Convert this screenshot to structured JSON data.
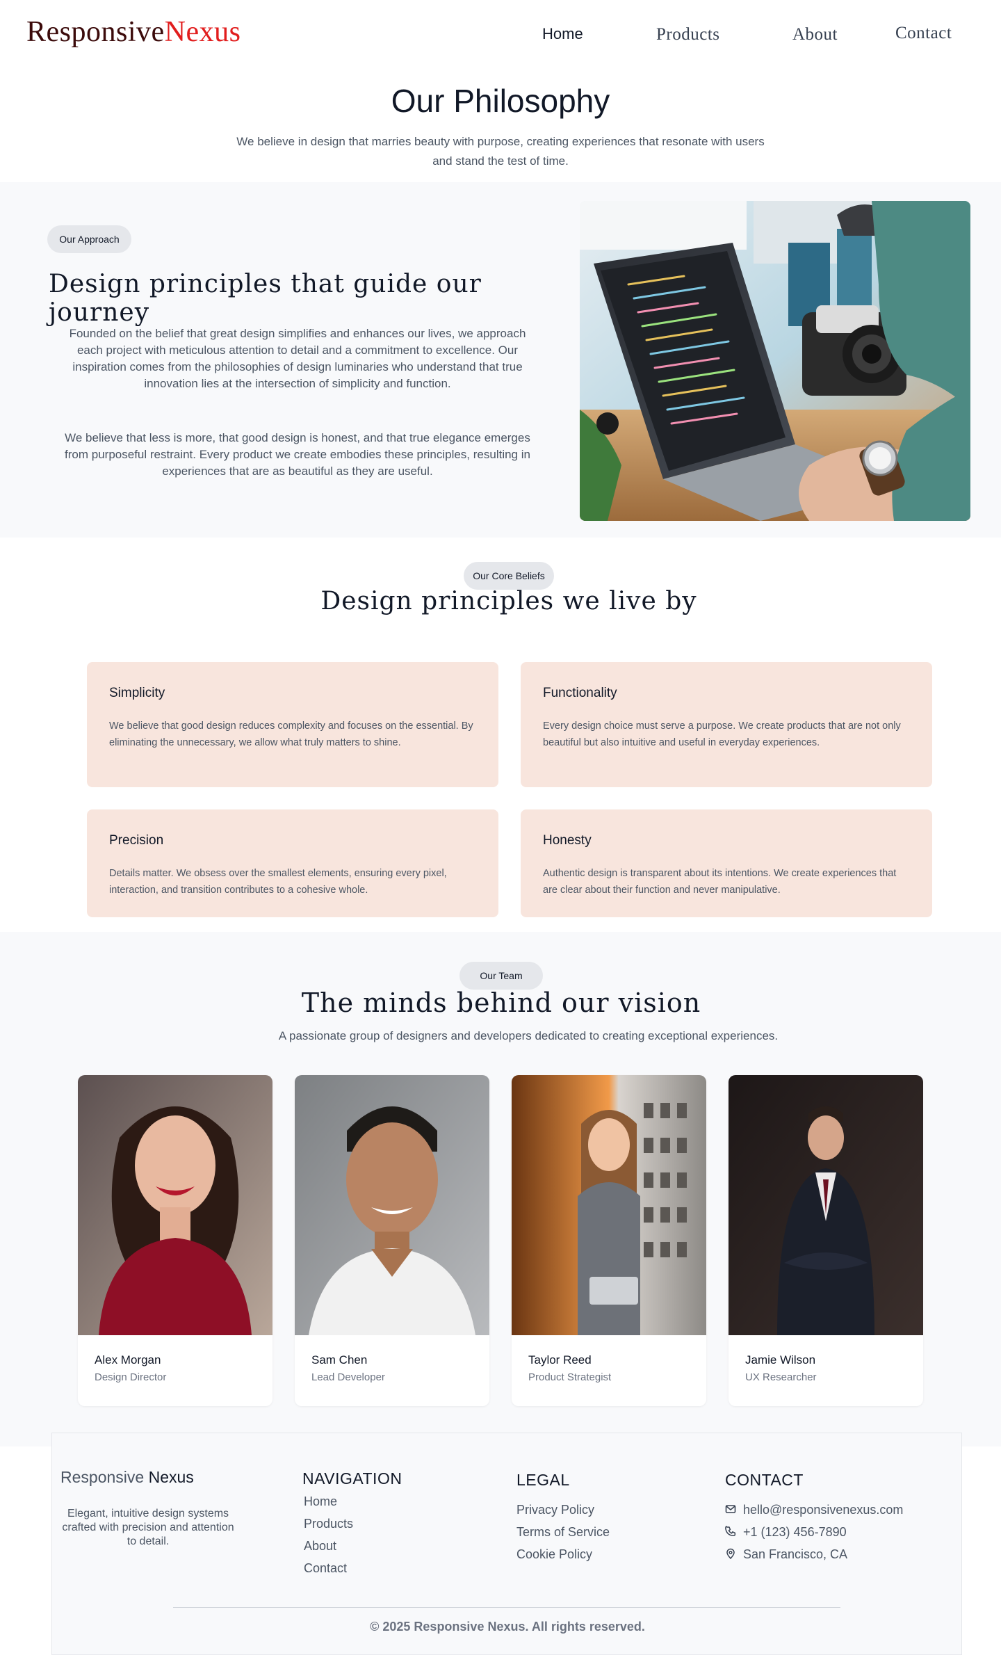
{
  "header": {
    "logo_part1": "Responsive",
    "logo_part2": "Nexus",
    "nav": [
      "Home",
      "Products",
      "About",
      "Contact"
    ]
  },
  "philosophy": {
    "title": "Our Philosophy",
    "subtitle": "We believe in design that marries beauty with purpose, creating experiences that resonate with users and stand the test of time."
  },
  "approach": {
    "badge": "Our Approach",
    "heading": "Design principles that guide our journey",
    "paragraph1": "Founded on the belief that great design simplifies and enhances our lives, we approach each project with meticulous attention to detail and a commitment to excellence. Our inspiration comes from the philosophies of design luminaries who understand that true innovation lies at the intersection of simplicity and function.",
    "paragraph2": "We believe that less is more, that good design is honest, and that true elegance emerges from purposeful restraint. Every product we create embodies these principles, resulting in experiences that are as beautiful as they are useful."
  },
  "beliefs": {
    "badge": "Our Core Beliefs",
    "heading": "Design principles we live by",
    "cards": [
      {
        "title": "Simplicity",
        "text": "We believe that good design reduces complexity and focuses on the essential. By eliminating the unnecessary, we allow what truly matters to shine."
      },
      {
        "title": "Functionality",
        "text": "Every design choice must serve a purpose. We create products that are not only beautiful but also intuitive and useful in everyday experiences."
      },
      {
        "title": "Precision",
        "text": "Details matter. We obsess over the smallest elements, ensuring every pixel, interaction, and transition contributes to a cohesive whole."
      },
      {
        "title": "Honesty",
        "text": "Authentic design is transparent about its intentions. We create experiences that are clear about their function and never manipulative."
      }
    ]
  },
  "team": {
    "badge": "Our Team",
    "heading": "The minds behind our vision",
    "subtitle": "A passionate group of designers and developers dedicated to creating exceptional experiences.",
    "members": [
      {
        "name": "Alex Morgan",
        "role": "Design Director"
      },
      {
        "name": "Sam Chen",
        "role": "Lead Developer"
      },
      {
        "name": "Taylor Reed",
        "role": "Product Strategist"
      },
      {
        "name": "Jamie Wilson",
        "role": "UX Researcher"
      }
    ]
  },
  "footer": {
    "brand_part1": "Responsive",
    "brand_part2": "Nexus",
    "description": "Elegant, intuitive design systems crafted with precision and attention to detail.",
    "navigation": {
      "heading": "NAVIGATION",
      "links": [
        "Home",
        "Products",
        "About",
        "Contact"
      ]
    },
    "legal": {
      "heading": "LEGAL",
      "links": [
        "Privacy Policy",
        "Terms of Service",
        "Cookie Policy"
      ]
    },
    "contact": {
      "heading": "CONTACT",
      "email": "hello@responsivenexus.com",
      "phone": "+1 (123) 456-7890",
      "location": "San Francisco, CA"
    },
    "copyright": "© 2025 Responsive Nexus. All rights reserved."
  },
  "colors": {
    "logo_dark": "#3b0a0a",
    "logo_accent": "#e11d1d",
    "card_bg": "#f8e5dd",
    "section_bg": "#f8f9fb"
  }
}
